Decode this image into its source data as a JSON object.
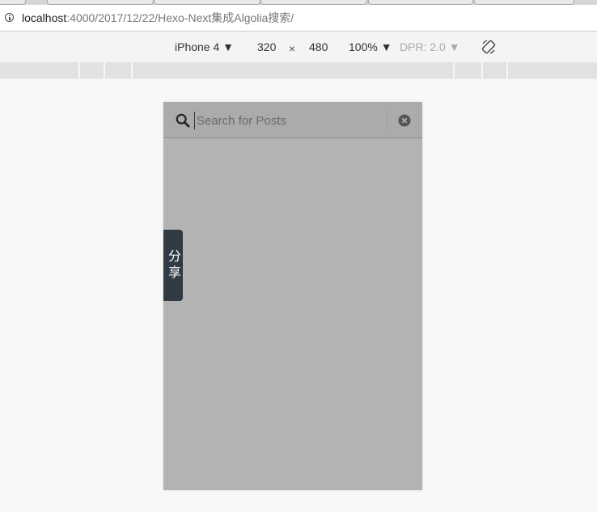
{
  "browser": {
    "url_host": "localhost",
    "url_path": ":4000/2017/12/22/Hexo-Next集成Algolia搜索/"
  },
  "device_toolbar": {
    "device": "iPhone 4 ▼",
    "width": "320",
    "times": "×",
    "height": "480",
    "zoom": "100% ▼",
    "dpr": "DPR: 2.0 ▼"
  },
  "page": {
    "search": {
      "placeholder": "Search for Posts",
      "value": ""
    },
    "share_tab": {
      "label": "分享"
    }
  },
  "colors": {
    "overlay": "#b3b3b3",
    "share_tab": "#323b44"
  },
  "icons": [
    "info-icon",
    "rotate-icon",
    "search-icon",
    "close-icon"
  ]
}
